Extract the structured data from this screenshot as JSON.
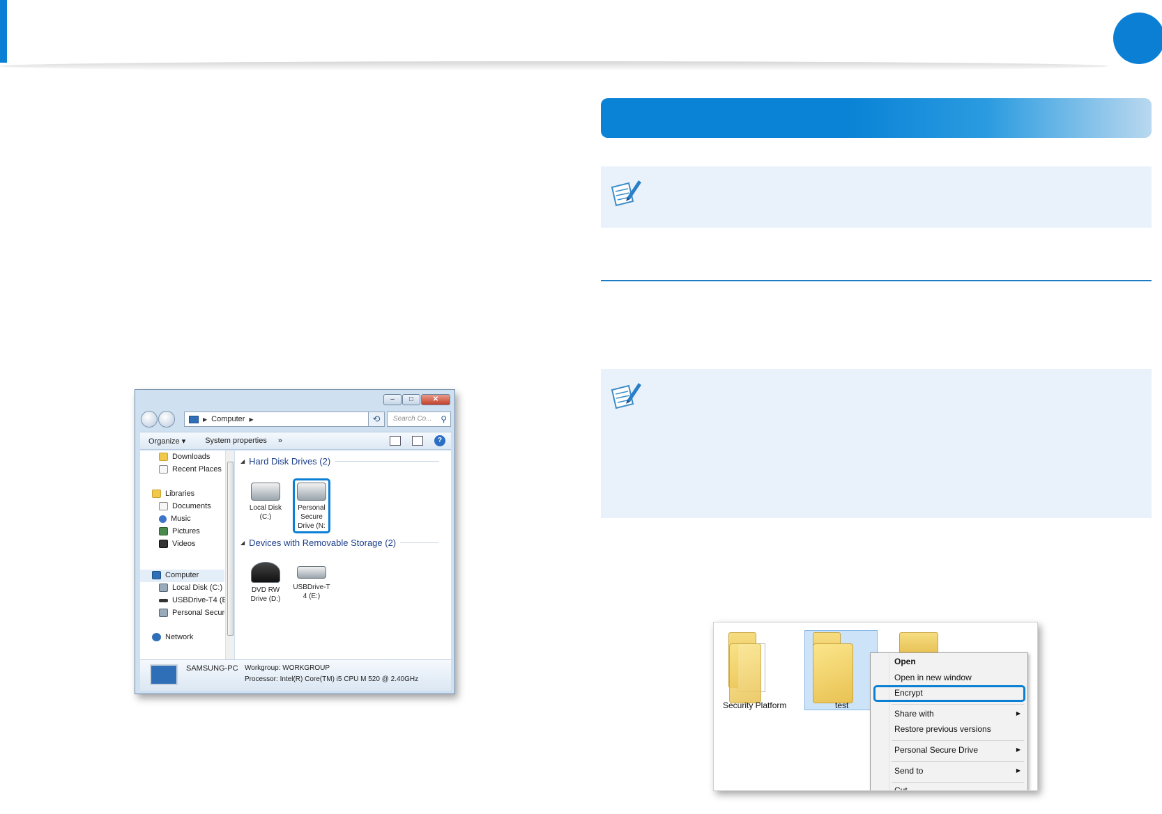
{
  "explorer": {
    "title_controls": {
      "minimize": "–",
      "maximize": "□",
      "close": "✕"
    },
    "address": {
      "location": "Computer"
    },
    "search": {
      "placeholder": "Search Co..."
    },
    "toolbar": {
      "organize": "Organize ▾",
      "system_properties": "System properties",
      "more": "»"
    },
    "nav": {
      "downloads": "Downloads",
      "recent_places": "Recent Places",
      "libraries": "Libraries",
      "documents": "Documents",
      "music": "Music",
      "pictures": "Pictures",
      "videos": "Videos",
      "computer": "Computer",
      "local_disk": "Local Disk (C:)",
      "usb_drive": "USBDrive-T4 (E:)",
      "personal_secure": "Personal Secure [",
      "network": "Network"
    },
    "groups": {
      "hdd": "Hard Disk Drives (2)",
      "removable": "Devices with Removable Storage (2)"
    },
    "drives": {
      "local_disk_l1": "Local Disk",
      "local_disk_l2": "(C:)",
      "psd_l1": "Personal",
      "psd_l2": "Secure",
      "psd_l3": "Drive (N:",
      "dvd_l1": "DVD RW",
      "dvd_l2": "Drive (D:)",
      "usb_l1": "USBDrive-T",
      "usb_l2": "4 (E:)"
    },
    "details": {
      "pc_name": "SAMSUNG-PC",
      "workgroup": "Workgroup: WORKGROUP",
      "processor": "Processor: Intel(R) Core(TM) i5 CPU       M 520  @ 2.40GHz"
    }
  },
  "folders": {
    "security_platform": "Security Platform",
    "test": "test"
  },
  "context_menu": {
    "open": "Open",
    "open_new_window": "Open in new window",
    "encrypt": "Encrypt",
    "share_with": "Share with",
    "restore_previous": "Restore previous versions",
    "personal_secure_drive": "Personal Secure Drive",
    "send_to": "Send to",
    "cut": "Cut"
  },
  "colors": {
    "accent": "#0a7fd4",
    "note_bg": "#e9f2fb"
  }
}
